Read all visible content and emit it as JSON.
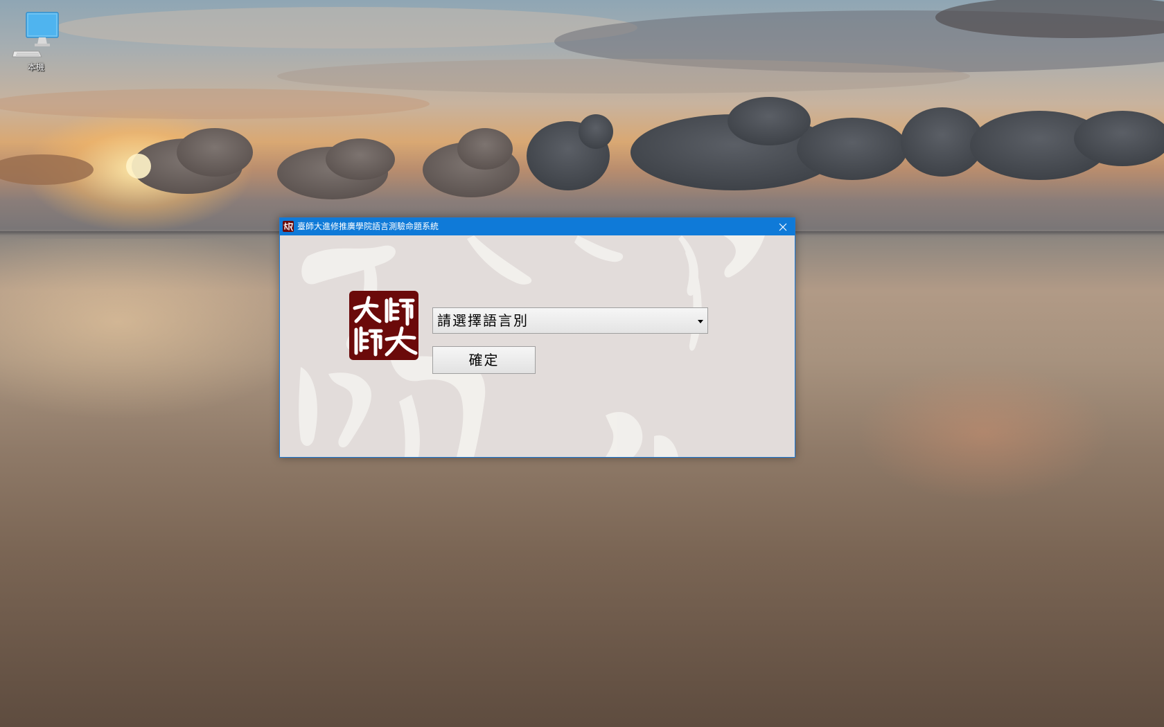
{
  "desktop": {
    "icons": [
      {
        "label": "本機",
        "icon": "computer-icon"
      }
    ]
  },
  "window": {
    "title": "臺師大進修推廣學院語言測驗命題系統",
    "close_icon": "close-icon",
    "accent": "#0f7ad8"
  },
  "logo": {
    "text": "師大",
    "color": "#6b0a0a"
  },
  "language_select": {
    "value": "請選擇語言別",
    "icon": "dropdown-arrow-icon"
  },
  "confirm_button": {
    "label": "確定"
  }
}
